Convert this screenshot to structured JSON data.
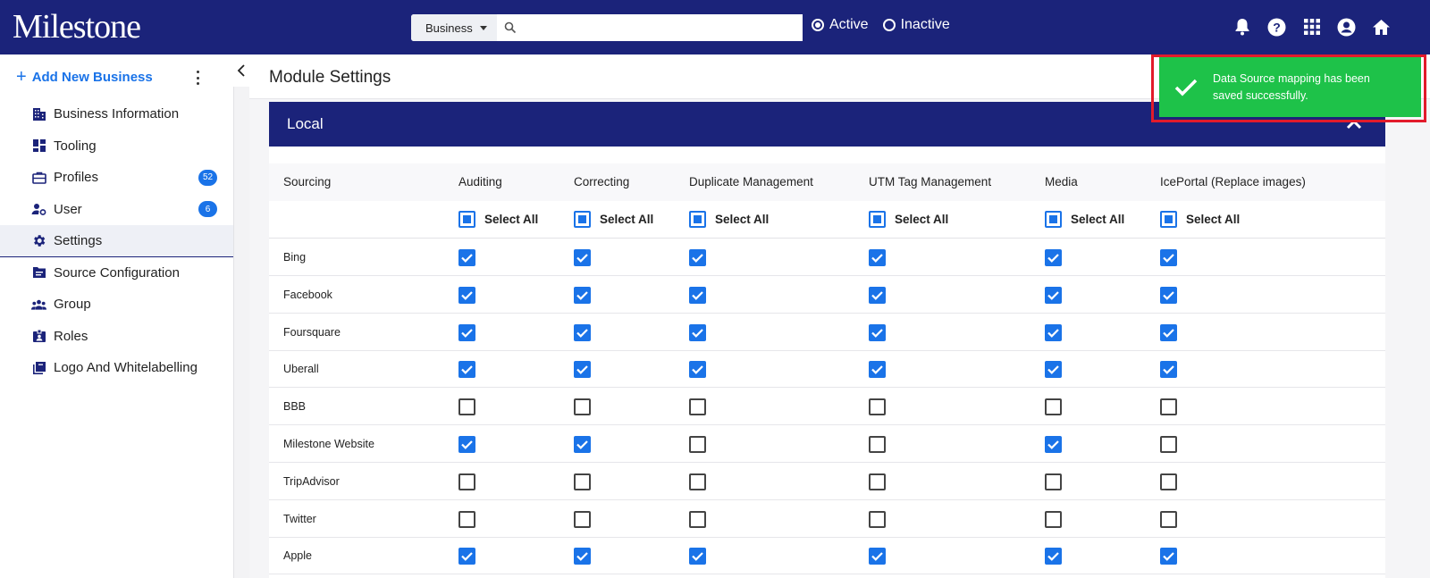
{
  "header": {
    "logo_text": "Milestone",
    "search": {
      "category": "Business",
      "placeholder": ""
    },
    "status_filter": {
      "active_label": "Active",
      "inactive_label": "Inactive",
      "selected": "Active"
    },
    "icons": [
      "bell-icon",
      "help-icon",
      "apps-grid-icon",
      "account-icon",
      "home-icon"
    ]
  },
  "sidebar": {
    "add_new_label": "Add New Business",
    "items": [
      {
        "label": "Business Information",
        "icon": "building-icon"
      },
      {
        "label": "Tooling",
        "icon": "dashboard-icon"
      },
      {
        "label": "Profiles",
        "icon": "briefcase-icon",
        "badge": "52"
      },
      {
        "label": "User",
        "icon": "user-gear-icon",
        "badge": "6"
      },
      {
        "label": "Settings",
        "icon": "gear-icon",
        "active": true
      },
      {
        "label": "Source Configuration",
        "icon": "folder-icon"
      },
      {
        "label": "Group",
        "icon": "group-icon"
      },
      {
        "label": "Roles",
        "icon": "badge-icon"
      },
      {
        "label": "Logo And Whitelabelling",
        "icon": "library-icon"
      }
    ]
  },
  "main": {
    "page_title": "Module Settings",
    "panel_title": "Local",
    "columns": {
      "sourcing": "Sourcing",
      "modules": [
        "Auditing",
        "Correcting",
        "Duplicate Management",
        "UTM Tag Management",
        "Media",
        "IcePortal (Replace images)"
      ]
    },
    "select_all_label": "Select All",
    "rows": [
      {
        "source": "Bing",
        "checks": [
          true,
          true,
          true,
          true,
          true,
          true
        ]
      },
      {
        "source": "Facebook",
        "checks": [
          true,
          true,
          true,
          true,
          true,
          true
        ]
      },
      {
        "source": "Foursquare",
        "checks": [
          true,
          true,
          true,
          true,
          true,
          true
        ]
      },
      {
        "source": "Uberall",
        "checks": [
          true,
          true,
          true,
          true,
          true,
          true
        ]
      },
      {
        "source": "BBB",
        "checks": [
          false,
          false,
          false,
          false,
          false,
          false
        ]
      },
      {
        "source": "Milestone Website",
        "checks": [
          true,
          true,
          false,
          false,
          true,
          false
        ]
      },
      {
        "source": "TripAdvisor",
        "checks": [
          false,
          false,
          false,
          false,
          false,
          false
        ]
      },
      {
        "source": "Twitter",
        "checks": [
          false,
          false,
          false,
          false,
          false,
          false
        ]
      },
      {
        "source": "Apple",
        "checks": [
          true,
          true,
          true,
          true,
          true,
          true
        ]
      }
    ]
  },
  "toast": {
    "message": "Data Source mapping has been saved successfully.",
    "color": "#1ec249",
    "highlight_color": "#e21b2b"
  },
  "colors": {
    "brand": "#1b237a",
    "accent": "#1a73e8"
  }
}
